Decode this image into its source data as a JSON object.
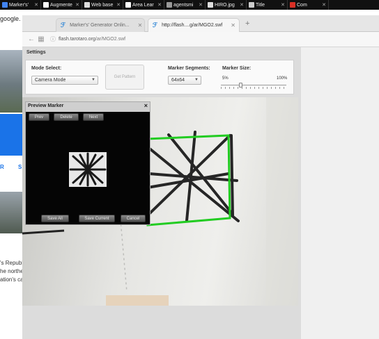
{
  "top_tabs": [
    {
      "label": "Marker's'",
      "color": "#4285f4"
    },
    {
      "label": "Augmente",
      "color": "#ffffff"
    },
    {
      "label": "Web base",
      "color": "#dddddd"
    },
    {
      "label": "Area Lear",
      "color": "#ffffff"
    },
    {
      "label": "agentsmi",
      "color": "#999999"
    },
    {
      "label": "HIRO.jpg",
      "color": "#dddddd"
    },
    {
      "label": "Title",
      "color": "#cccccc"
    },
    {
      "label": "Com",
      "color": "#d93025"
    }
  ],
  "bg_page": {
    "google": "google.",
    "links": [
      "R",
      "S"
    ],
    "lines": [
      "'s Republ",
      "he northe",
      "ation's ca"
    ]
  },
  "browser": {
    "tabs": [
      {
        "label": "Marker's' Generator Onlin..."
      },
      {
        "label": "http://flash....g/ar/MGO2.swf"
      }
    ],
    "new_tab": "+",
    "url_domain": "flash.tarotaro.org",
    "url_path": "/ar/MGO2.swf"
  },
  "app": {
    "settings_title": "Settings",
    "mode_label": "Mode Select:",
    "mode_value": "Camera Mode",
    "get_pattern": "Get Pattern",
    "segments_label": "Marker Segments:",
    "segments_value": "64x64",
    "size_label": "Marker Size:",
    "size_min": "5%",
    "size_max": "100%",
    "size_level": 0.3
  },
  "preview": {
    "title": "Preview Marker",
    "close": "×",
    "buttons_top": [
      "Prev",
      "Delete",
      "Next"
    ],
    "buttons_bottom": [
      "Save All",
      "Save Current",
      "Cancel"
    ]
  }
}
